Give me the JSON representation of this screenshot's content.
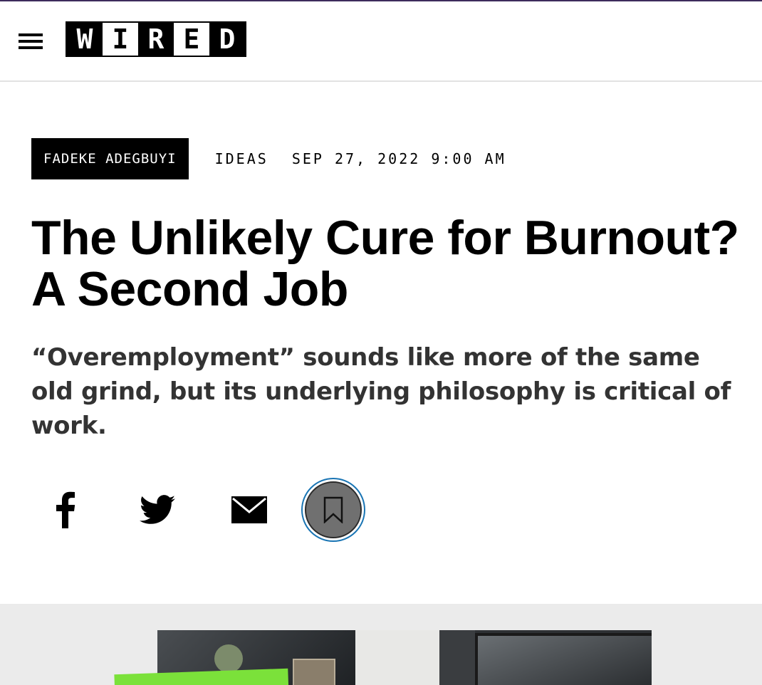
{
  "header": {
    "menu_icon": "hamburger-menu-icon",
    "logo": [
      "W",
      "I",
      "R",
      "E",
      "D"
    ]
  },
  "article": {
    "author": "FADEKE ADEGBUYI",
    "category": "IDEAS",
    "date": "SEP 27, 2022 9:00 AM",
    "headline": "The Unlikely Cure for Burnout? A Second Job",
    "dek": "“Overemployment” sounds like more of the same old grind, but its underlying philosophy is critical of work."
  },
  "share": {
    "icons": [
      "facebook-icon",
      "twitter-icon",
      "email-icon",
      "bookmark-icon"
    ]
  },
  "colors": {
    "top_strip": "#3d2b5c",
    "save_ring": "#1a75b4",
    "lead_band": "#ebebeb"
  }
}
